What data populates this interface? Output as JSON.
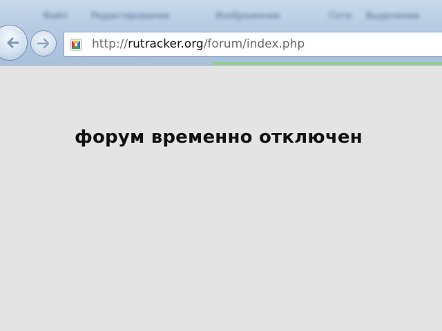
{
  "browser": {
    "menu_items": [
      "Файл",
      "Редактирование",
      "Изображение",
      "Сети",
      "Выделение"
    ],
    "address": {
      "url_prefix": "http://",
      "url_host": "rutracker.org",
      "url_path": "/forum/index.php"
    },
    "icons": {
      "back": "back-arrow-icon",
      "forward": "forward-arrow-icon",
      "site": "site-favicon-icon"
    },
    "colors": {
      "chrome": "#b7cbe3",
      "loading_strip": "#8fcf8a",
      "page_background": "#e4e4e4"
    }
  },
  "page": {
    "message": "форум временно отключен"
  }
}
